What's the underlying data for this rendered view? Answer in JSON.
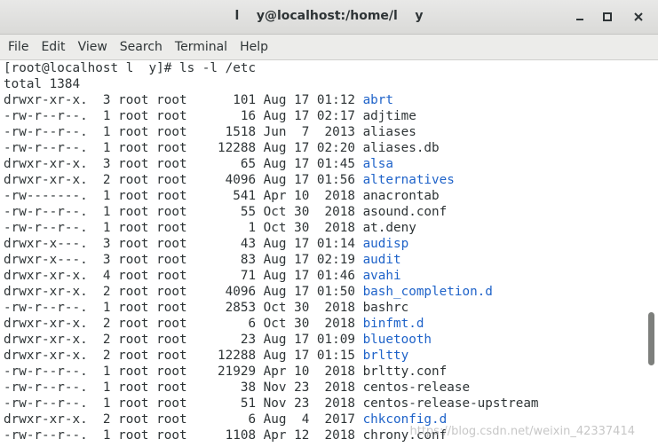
{
  "window": {
    "title": "l    y@localhost:/home/l    y"
  },
  "menu": {
    "items": [
      "File",
      "Edit",
      "View",
      "Search",
      "Terminal",
      "Help"
    ]
  },
  "terminal": {
    "lines": [
      {
        "text": "[root@localhost l  y]# ls -l /etc"
      },
      {
        "text": "total 1384"
      },
      {
        "prefix": "drwxr-xr-x.  3 root root      101 Aug 17 01:12 ",
        "name": "abrt",
        "dir": true
      },
      {
        "prefix": "-rw-r--r--.  1 root root       16 Aug 17 02:17 ",
        "name": "adjtime",
        "dir": false
      },
      {
        "prefix": "-rw-r--r--.  1 root root     1518 Jun  7  2013 ",
        "name": "aliases",
        "dir": false
      },
      {
        "prefix": "-rw-r--r--.  1 root root    12288 Aug 17 02:20 ",
        "name": "aliases.db",
        "dir": false
      },
      {
        "prefix": "drwxr-xr-x.  3 root root       65 Aug 17 01:45 ",
        "name": "alsa",
        "dir": true
      },
      {
        "prefix": "drwxr-xr-x.  2 root root     4096 Aug 17 01:56 ",
        "name": "alternatives",
        "dir": true
      },
      {
        "prefix": "-rw-------.  1 root root      541 Apr 10  2018 ",
        "name": "anacrontab",
        "dir": false
      },
      {
        "prefix": "-rw-r--r--.  1 root root       55 Oct 30  2018 ",
        "name": "asound.conf",
        "dir": false
      },
      {
        "prefix": "-rw-r--r--.  1 root root        1 Oct 30  2018 ",
        "name": "at.deny",
        "dir": false
      },
      {
        "prefix": "drwxr-x---.  3 root root       43 Aug 17 01:14 ",
        "name": "audisp",
        "dir": true
      },
      {
        "prefix": "drwxr-x---.  3 root root       83 Aug 17 02:19 ",
        "name": "audit",
        "dir": true
      },
      {
        "prefix": "drwxr-xr-x.  4 root root       71 Aug 17 01:46 ",
        "name": "avahi",
        "dir": true
      },
      {
        "prefix": "drwxr-xr-x.  2 root root     4096 Aug 17 01:50 ",
        "name": "bash_completion.d",
        "dir": true
      },
      {
        "prefix": "-rw-r--r--.  1 root root     2853 Oct 30  2018 ",
        "name": "bashrc",
        "dir": false
      },
      {
        "prefix": "drwxr-xr-x.  2 root root        6 Oct 30  2018 ",
        "name": "binfmt.d",
        "dir": true
      },
      {
        "prefix": "drwxr-xr-x.  2 root root       23 Aug 17 01:09 ",
        "name": "bluetooth",
        "dir": true
      },
      {
        "prefix": "drwxr-xr-x.  2 root root    12288 Aug 17 01:15 ",
        "name": "brltty",
        "dir": true
      },
      {
        "prefix": "-rw-r--r--.  1 root root    21929 Apr 10  2018 ",
        "name": "brltty.conf",
        "dir": false
      },
      {
        "prefix": "-rw-r--r--.  1 root root       38 Nov 23  2018 ",
        "name": "centos-release",
        "dir": false
      },
      {
        "prefix": "-rw-r--r--.  1 root root       51 Nov 23  2018 ",
        "name": "centos-release-upstream",
        "dir": false
      },
      {
        "prefix": "drwxr-xr-x.  2 root root        6 Aug  4  2017 ",
        "name": "chkconfig.d",
        "dir": true
      },
      {
        "prefix": "-rw-r--r--.  1 root root     1108 Apr 12  2018 ",
        "name": "chrony.conf",
        "dir": false
      }
    ]
  },
  "watermark": "https://blog.csdn.net/weixin_42337414",
  "colors": {
    "directory": "#1f63c9",
    "text": "#2e3436"
  },
  "icons": {
    "minimize": "minimize-icon",
    "maximize": "maximize-icon",
    "close": "close-icon"
  }
}
